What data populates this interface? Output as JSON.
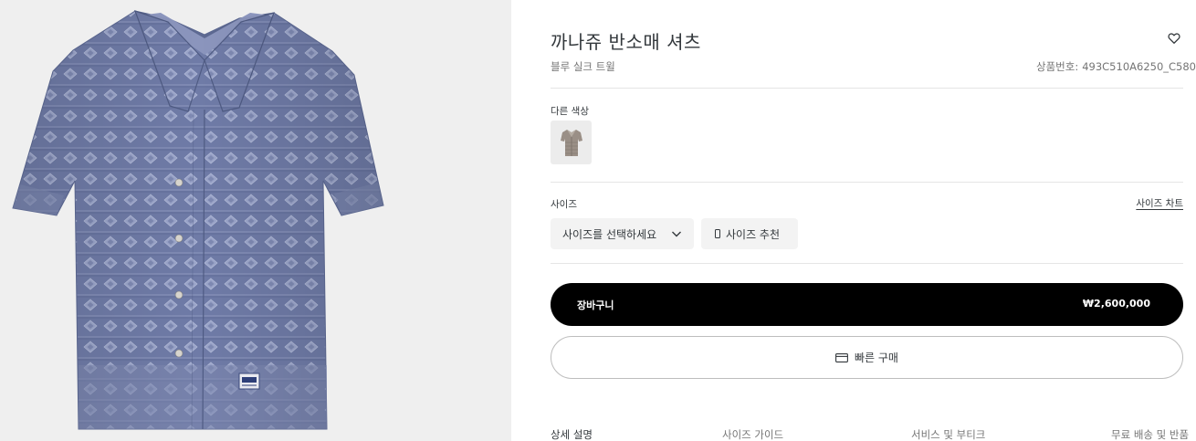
{
  "product": {
    "title": "까나쥬 반소매 셔츠",
    "subtitle": "블루 실크 트윌",
    "sku_label": "상품번호:",
    "sku_value": "493C510A6250_C580"
  },
  "colors": {
    "label": "다른 색상",
    "swatches": [
      {
        "name": "beige"
      }
    ]
  },
  "size": {
    "label": "사이즈",
    "chart_link": "사이즈 차트",
    "select_placeholder": "사이즈를 선택하세요",
    "recommend_label": "사이즈 추천"
  },
  "actions": {
    "cart_label": "장바구니",
    "price": "₩2,600,000",
    "quick_buy_label": "빠른 구매"
  },
  "tabs": [
    {
      "label": "상세 설명"
    },
    {
      "label": "사이즈 가이드"
    },
    {
      "label": "서비스 및 부티크"
    },
    {
      "label": "무료 배송 및 반품"
    }
  ],
  "icons": {
    "wishlist": "heart-outline-icon",
    "dropdown": "chevron-down-icon",
    "recommend": "smartphone-icon",
    "quick_buy": "credit-card-icon"
  },
  "theme": {
    "text": "#33383c",
    "muted": "#757575",
    "cart_bg": "#000000",
    "image_bg": "#efefef",
    "shirt_blue": "#6f7ba7"
  }
}
